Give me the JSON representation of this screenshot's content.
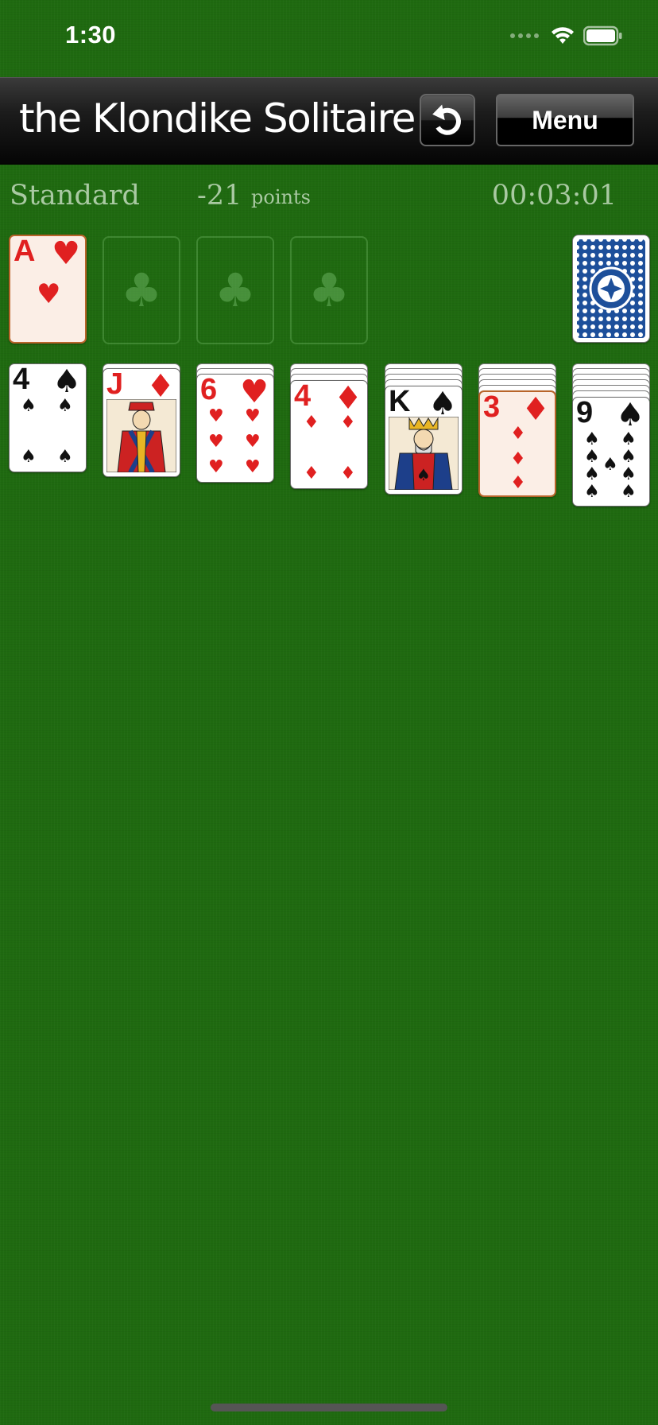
{
  "status_bar": {
    "time": "1:30"
  },
  "header": {
    "title": "the Klondike Solitaire",
    "menu_label": "Menu"
  },
  "info": {
    "mode": "Standard",
    "score": "-21",
    "score_unit": "points",
    "timer": "00:03:01"
  },
  "colors": {
    "felt": "#1f6a10",
    "info_text": "#a9c9a2",
    "red_suit": "#e02020",
    "highlight_card": "#fbeee6"
  },
  "foundations": [
    {
      "rank": "A",
      "suit": "♥",
      "color": "red"
    },
    {
      "empty_suit": "♣"
    },
    {
      "empty_suit": "♣"
    },
    {
      "empty_suit": "♣"
    }
  ],
  "stock": {
    "icon": "card-back-blue"
  },
  "tableau": [
    {
      "rank": "4",
      "suit": "♠",
      "color": "black",
      "hidden_cards": 0
    },
    {
      "rank": "J",
      "suit": "♦",
      "color": "red",
      "hidden_cards": 1,
      "face": "jack"
    },
    {
      "rank": "6",
      "suit": "♥",
      "color": "red",
      "hidden_cards": 2
    },
    {
      "rank": "4",
      "suit": "♦",
      "color": "red",
      "hidden_cards": 3
    },
    {
      "rank": "K",
      "suit": "♠",
      "color": "black",
      "hidden_cards": 4,
      "face": "king"
    },
    {
      "rank": "3",
      "suit": "♦",
      "color": "red",
      "hidden_cards": 5,
      "highlighted": true
    },
    {
      "rank": "9",
      "suit": "♠",
      "color": "black",
      "hidden_cards": 6
    }
  ]
}
